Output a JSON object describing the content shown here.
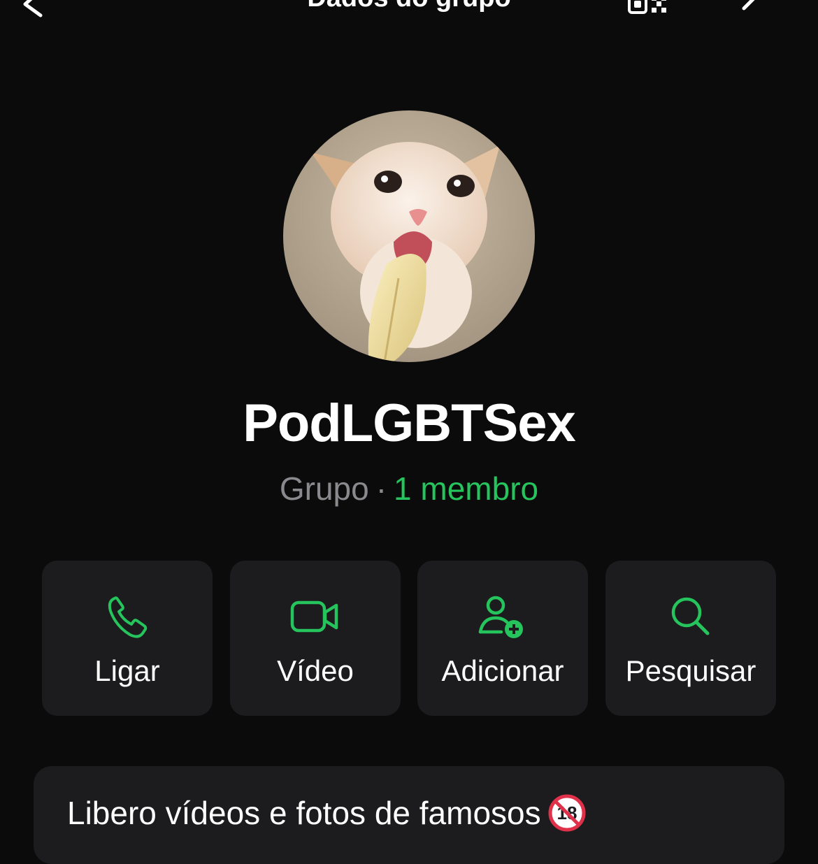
{
  "header": {
    "title": "Dados do grupo",
    "back_icon": "chevron-left-icon",
    "qr_icon": "qr-code-icon",
    "edit_icon": "pencil-icon"
  },
  "group": {
    "name": "PodLGBTSex",
    "kind": "Grupo",
    "separator": "·",
    "members": "1 membro",
    "avatar": "cat-licking-banana-photo"
  },
  "actions": [
    {
      "label": "Ligar",
      "icon": "phone-icon"
    },
    {
      "label": "Vídeo",
      "icon": "video-camera-icon"
    },
    {
      "label": "Adicionar",
      "icon": "add-person-icon"
    },
    {
      "label": "Pesquisar",
      "icon": "search-icon"
    }
  ],
  "description": {
    "text": "Libero vídeos e fotos de famosos",
    "emoji": "no-one-under-eighteen-icon"
  },
  "colors": {
    "background": "#0b0b0b",
    "card": "#1c1c1e",
    "accent_green": "#25c45d",
    "muted_gray": "#8a8a8e"
  }
}
